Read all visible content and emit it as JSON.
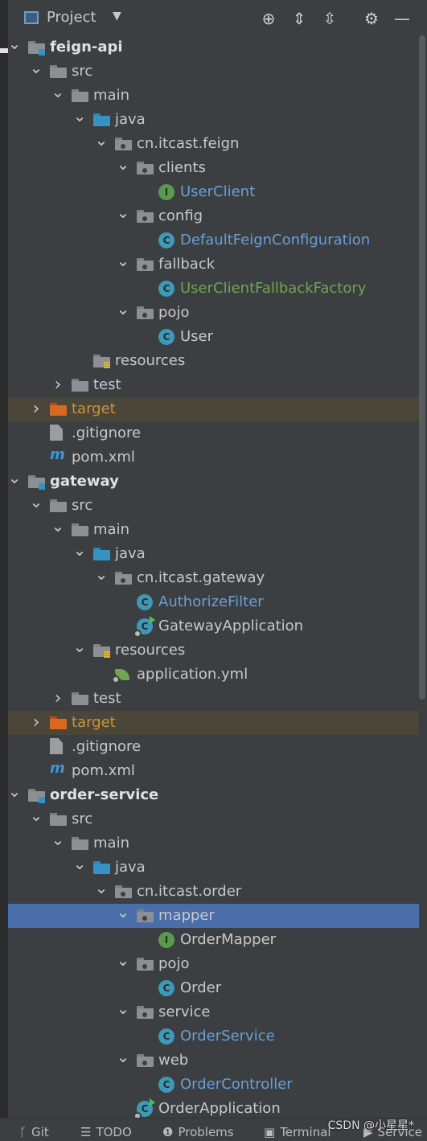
{
  "header": {
    "title": "Project",
    "buttons": [
      {
        "name": "locate-icon",
        "glyph": "⊕"
      },
      {
        "name": "expand-all-icon",
        "glyph": "⇕"
      },
      {
        "name": "collapse-all-icon",
        "glyph": "⇳"
      },
      {
        "name": "gear-icon",
        "glyph": "⚙"
      },
      {
        "name": "minimize-icon",
        "glyph": "—"
      }
    ]
  },
  "tree": [
    {
      "depth": 1,
      "arrow": "open",
      "icon": "module-folder",
      "label": "feign-api",
      "style": "bold"
    },
    {
      "depth": 2,
      "arrow": "open",
      "icon": "folder",
      "label": "src"
    },
    {
      "depth": 3,
      "arrow": "open",
      "icon": "folder",
      "label": "main"
    },
    {
      "depth": 4,
      "arrow": "open",
      "icon": "blue-folder",
      "label": "java"
    },
    {
      "depth": 5,
      "arrow": "open",
      "icon": "package",
      "label": "cn.itcast.feign"
    },
    {
      "depth": 6,
      "arrow": "open",
      "icon": "package",
      "label": "clients"
    },
    {
      "depth": 7,
      "arrow": "none",
      "icon": "interface",
      "label": "UserClient",
      "style": "blue"
    },
    {
      "depth": 6,
      "arrow": "open",
      "icon": "package",
      "label": "config"
    },
    {
      "depth": 7,
      "arrow": "none",
      "icon": "class",
      "label": "DefaultFeignConfiguration",
      "style": "blue"
    },
    {
      "depth": 6,
      "arrow": "open",
      "icon": "package",
      "label": "fallback"
    },
    {
      "depth": 7,
      "arrow": "none",
      "icon": "class",
      "label": "UserClientFallbackFactory",
      "style": "green"
    },
    {
      "depth": 6,
      "arrow": "open",
      "icon": "package",
      "label": "pojo"
    },
    {
      "depth": 7,
      "arrow": "none",
      "icon": "class",
      "label": "User"
    },
    {
      "depth": 4,
      "arrow": "none",
      "icon": "resources",
      "label": "resources"
    },
    {
      "depth": 3,
      "arrow": "closed",
      "icon": "folder",
      "label": "test"
    },
    {
      "depth": 2,
      "arrow": "closed",
      "icon": "orange-folder",
      "label": "target",
      "style": "orange",
      "highlight": "target"
    },
    {
      "depth": 2,
      "arrow": "none",
      "icon": "gitignore",
      "label": ".gitignore"
    },
    {
      "depth": 2,
      "arrow": "none",
      "icon": "maven",
      "label": "pom.xml"
    },
    {
      "depth": 1,
      "arrow": "open",
      "icon": "module-folder",
      "label": "gateway",
      "style": "bold"
    },
    {
      "depth": 2,
      "arrow": "open",
      "icon": "folder",
      "label": "src"
    },
    {
      "depth": 3,
      "arrow": "open",
      "icon": "folder",
      "label": "main"
    },
    {
      "depth": 4,
      "arrow": "open",
      "icon": "blue-folder",
      "label": "java"
    },
    {
      "depth": 5,
      "arrow": "open",
      "icon": "package",
      "label": "cn.itcast.gateway"
    },
    {
      "depth": 6,
      "arrow": "none",
      "icon": "class",
      "label": "AuthorizeFilter",
      "style": "blue"
    },
    {
      "depth": 6,
      "arrow": "none",
      "icon": "spring-app",
      "label": "GatewayApplication"
    },
    {
      "depth": 4,
      "arrow": "open",
      "icon": "resources",
      "label": "resources"
    },
    {
      "depth": 5,
      "arrow": "none",
      "icon": "spring-yml",
      "label": "application.yml"
    },
    {
      "depth": 3,
      "arrow": "closed",
      "icon": "folder",
      "label": "test"
    },
    {
      "depth": 2,
      "arrow": "closed",
      "icon": "orange-folder",
      "label": "target",
      "style": "orange",
      "highlight": "target"
    },
    {
      "depth": 2,
      "arrow": "none",
      "icon": "gitignore",
      "label": ".gitignore"
    },
    {
      "depth": 2,
      "arrow": "none",
      "icon": "maven",
      "label": "pom.xml"
    },
    {
      "depth": 1,
      "arrow": "open",
      "icon": "module-folder",
      "label": "order-service",
      "style": "bold"
    },
    {
      "depth": 2,
      "arrow": "open",
      "icon": "folder",
      "label": "src"
    },
    {
      "depth": 3,
      "arrow": "open",
      "icon": "folder",
      "label": "main"
    },
    {
      "depth": 4,
      "arrow": "open",
      "icon": "blue-folder",
      "label": "java"
    },
    {
      "depth": 5,
      "arrow": "open",
      "icon": "package",
      "label": "cn.itcast.order"
    },
    {
      "depth": 6,
      "arrow": "open",
      "icon": "package",
      "label": "mapper",
      "highlight": "selected"
    },
    {
      "depth": 7,
      "arrow": "none",
      "icon": "interface",
      "label": "OrderMapper"
    },
    {
      "depth": 6,
      "arrow": "open",
      "icon": "package",
      "label": "pojo"
    },
    {
      "depth": 7,
      "arrow": "none",
      "icon": "class",
      "label": "Order"
    },
    {
      "depth": 6,
      "arrow": "open",
      "icon": "package",
      "label": "service"
    },
    {
      "depth": 7,
      "arrow": "none",
      "icon": "class",
      "label": "OrderService",
      "style": "blue"
    },
    {
      "depth": 6,
      "arrow": "open",
      "icon": "package",
      "label": "web"
    },
    {
      "depth": 7,
      "arrow": "none",
      "icon": "class",
      "label": "OrderController",
      "style": "blue"
    },
    {
      "depth": 6,
      "arrow": "none",
      "icon": "spring-app",
      "label": "OrderApplication"
    }
  ],
  "bottom_bar": {
    "items": [
      {
        "name": "git",
        "label": "Git",
        "icon": "branch-icon",
        "glyph": "ᚴ"
      },
      {
        "name": "todo",
        "label": "TODO",
        "icon": "list-icon",
        "glyph": "☰"
      },
      {
        "name": "problems",
        "label": "Problems",
        "icon": "problems-icon",
        "glyph": "❶"
      },
      {
        "name": "terminal",
        "label": "Terminal",
        "icon": "terminal-icon",
        "glyph": "▣"
      },
      {
        "name": "services",
        "label": "Service",
        "icon": "services-icon",
        "glyph": "▶"
      }
    ],
    "watermark": "CSDN @小星星*"
  },
  "colors": {
    "background": "#3c3f41",
    "selection": "#4a6ea9",
    "target_row": "#4a463a",
    "label_blue": "#6b9ed6",
    "label_green": "#6fa553",
    "label_orange": "#c8943a"
  }
}
